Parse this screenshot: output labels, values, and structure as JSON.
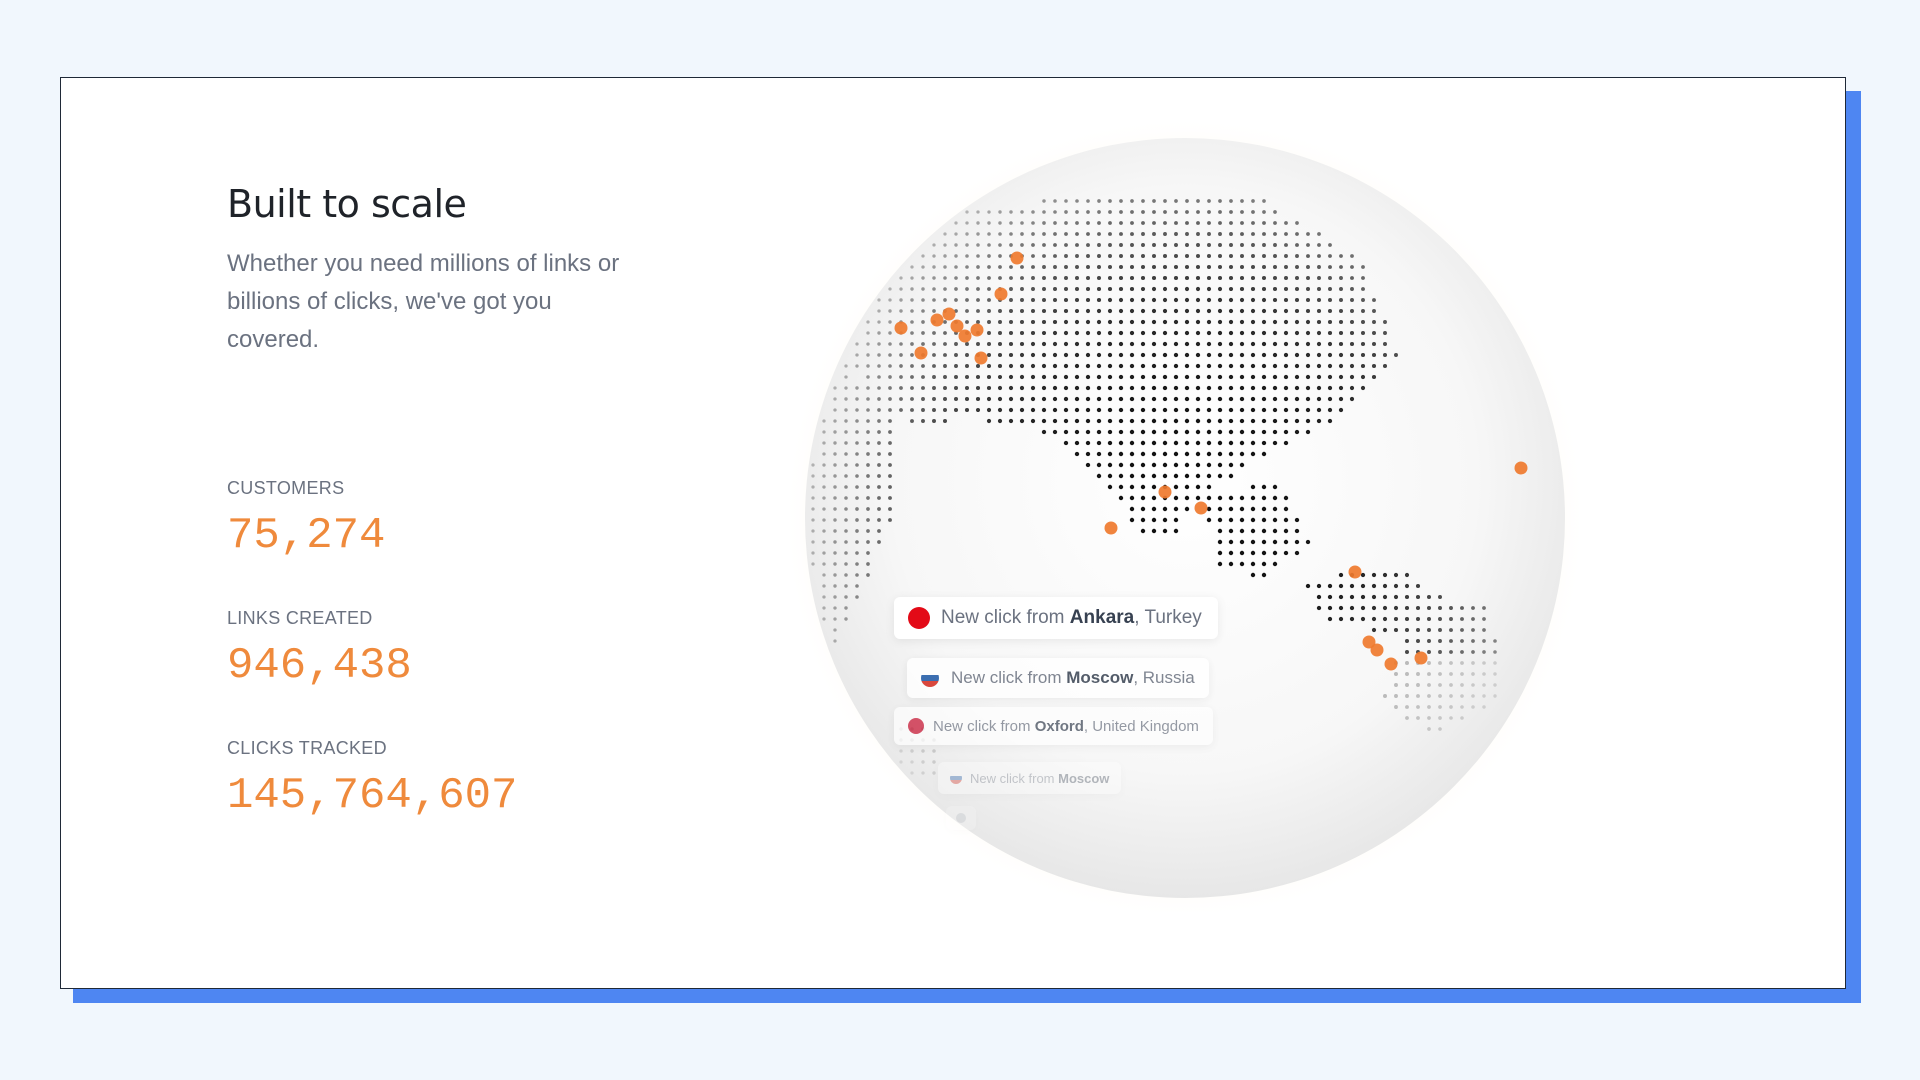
{
  "hero": {
    "title": "Built to scale",
    "subtitle": "Whether you need millions of links or billions of clicks, we've got you covered."
  },
  "stats": [
    {
      "label": "CUSTOMERS",
      "value": "75,274"
    },
    {
      "label": "LINKS CREATED",
      "value": "946,438"
    },
    {
      "label": "CLICKS TRACKED",
      "value": "145,764,607"
    }
  ],
  "colors": {
    "accent": "#ef8a3c",
    "frame": "#4e86f2",
    "background": "#f1f7fd"
  },
  "toasts": [
    {
      "prefix": "New click from",
      "city": "Ankara",
      "country": "Turkey",
      "flag": "turkey-flag-icon"
    },
    {
      "prefix": "New click from",
      "city": "Moscow",
      "country": "Russia",
      "flag": "russia-flag-icon"
    },
    {
      "prefix": "New click from",
      "city": "Oxford",
      "country": "United Kingdom",
      "flag": "uk-flag-icon"
    },
    {
      "prefix": "New click from",
      "city": "Moscow",
      "country": "",
      "flag": "russia-flag-icon"
    }
  ]
}
